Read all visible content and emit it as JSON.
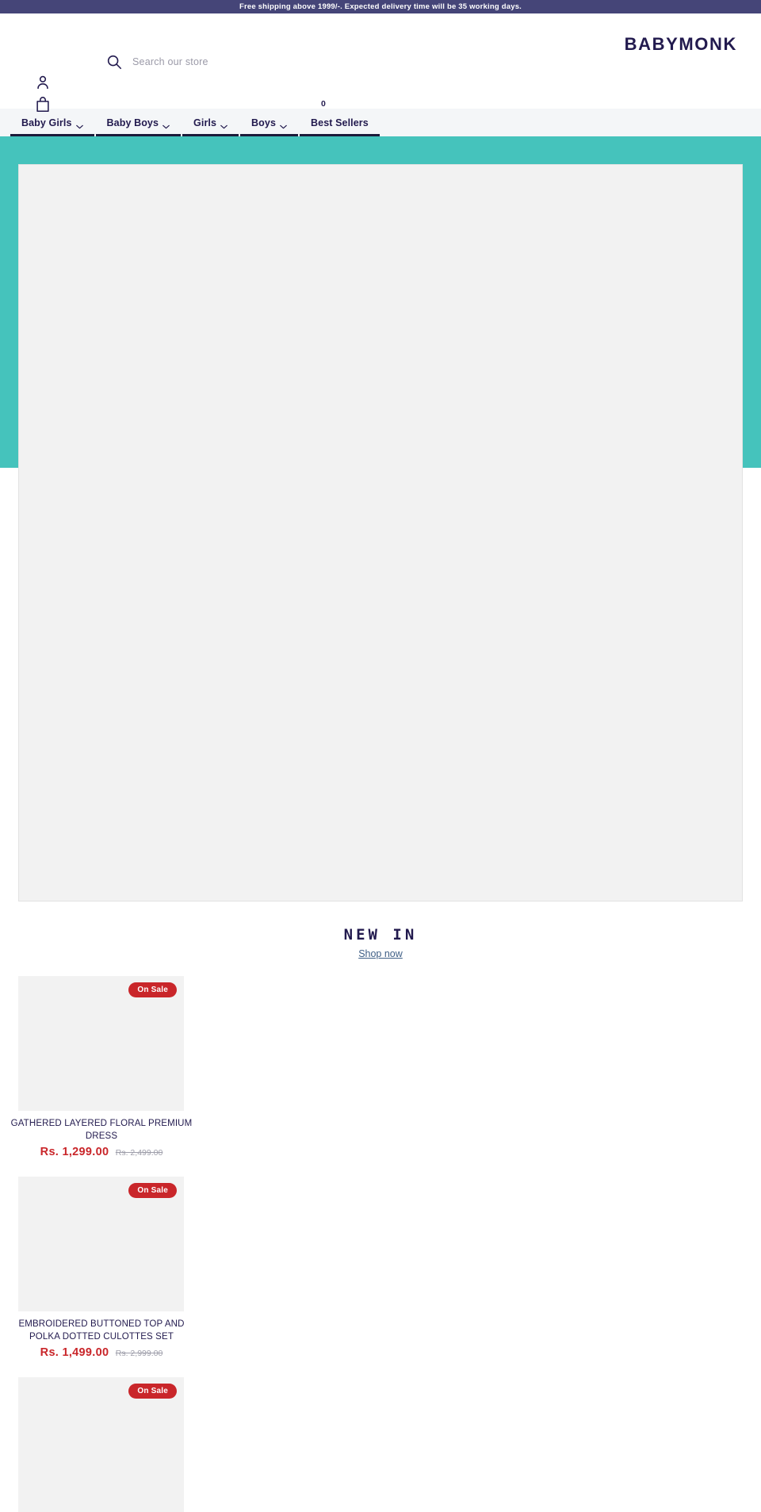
{
  "announcement": {
    "text": "Free shipping above 1999/-. Expected delivery time will be 35 working days."
  },
  "header": {
    "logo": "BABYMONK",
    "search_placeholder": "Search our store",
    "search_value": "",
    "cart_count": "0",
    "icons": {
      "search": "search-icon",
      "account": "user-icon",
      "cart": "shopping-bag-icon"
    }
  },
  "nav": {
    "items": [
      {
        "label": "Baby Girls",
        "has_dropdown": true
      },
      {
        "label": "Baby Boys",
        "has_dropdown": true
      },
      {
        "label": "Girls",
        "has_dropdown": true
      },
      {
        "label": "Boys",
        "has_dropdown": true
      },
      {
        "label": "Best Sellers",
        "has_dropdown": false
      }
    ]
  },
  "section": {
    "title": "NEW IN",
    "link": "Shop now"
  },
  "products": [
    {
      "badge": "On Sale",
      "title": "GATHERED LAYERED FLORAL PREMIUM DRESS",
      "price": "Rs. 1,299.00",
      "compare_at": "Rs. 2,499.00"
    },
    {
      "badge": "On Sale",
      "title": "EMBROIDERED BUTTONED TOP AND POLKA DOTTED CULOTTES SET",
      "price": "Rs. 1,499.00",
      "compare_at": "Rs. 2,999.00"
    },
    {
      "badge": "On Sale",
      "title": "",
      "price": "",
      "compare_at": ""
    }
  ],
  "colors": {
    "announcement_bg": "#454578",
    "hero_bg": "#45c3bc",
    "brand_text": "#221a4e",
    "sale_red": "#c9262a",
    "nav_bg": "#f4f6f8"
  }
}
